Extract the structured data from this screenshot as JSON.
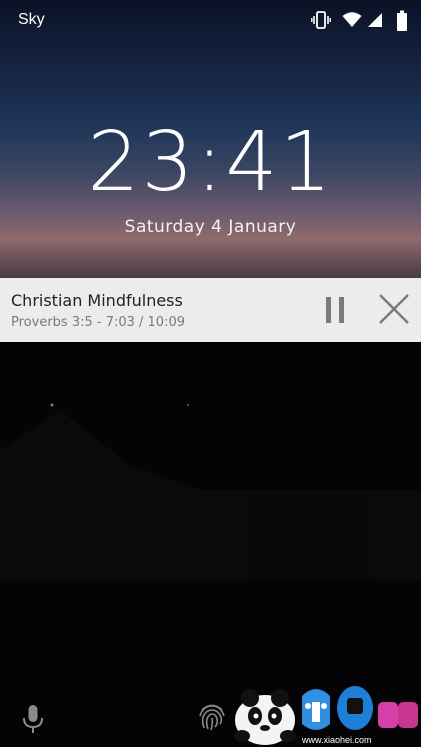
{
  "status_bar": {
    "carrier": "Sky",
    "icons": [
      "vibrate-icon",
      "wifi-icon",
      "signal-icon",
      "battery-icon"
    ]
  },
  "lockscreen": {
    "time": "23:41",
    "date": "Saturday 4 January"
  },
  "media_notification": {
    "title": "Christian Mindfulness",
    "subtitle": "Proverbs 3:5 - 7:03 / 10:09",
    "pause_icon": "pause-icon",
    "close_icon": "close-icon"
  },
  "bottom": {
    "left_icon": "microphone-icon",
    "center_icon": "fingerprint-icon"
  },
  "watermark": {
    "text": "www.xiaohei.com",
    "logo": "panda-logo"
  },
  "colors": {
    "notification_bg": "#ececec",
    "text_primary": "#222222",
    "text_secondary": "#7a7a7a"
  }
}
